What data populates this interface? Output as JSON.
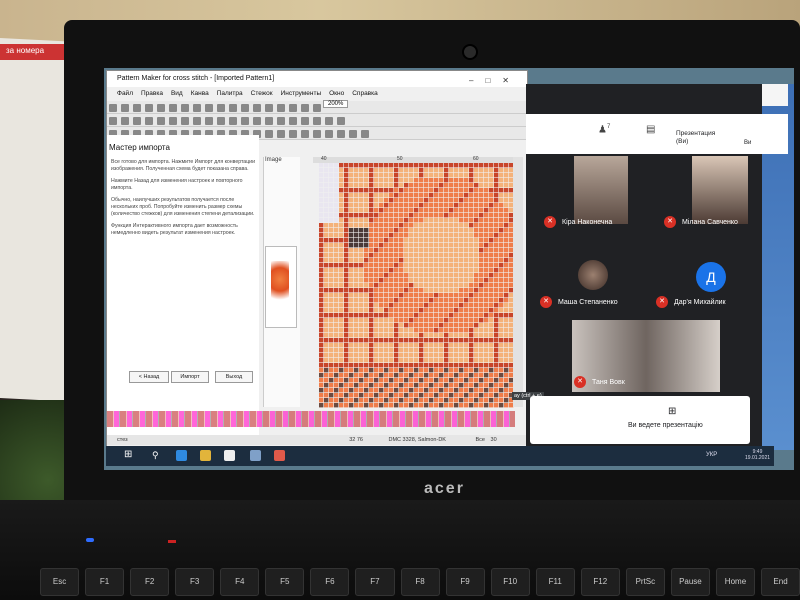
{
  "pattern_maker": {
    "title": "Pattern Maker for cross stitch - [Imported Pattern1]",
    "menu": [
      "Файл",
      "Правка",
      "Вид",
      "Канва",
      "Палитра",
      "Стежок",
      "Инструменты",
      "Окно",
      "Справка"
    ],
    "zoom": "200%",
    "wizard_title": "Мастер импорта",
    "wizard_paragraphs": [
      "Все готово для импорта. Нажмите Импорт для конвертации изображения. Полученная схема будет показана справа.",
      "Нажмите Назад для изменения настроек и повторного импорта.",
      "Обычно, наилучших результатов получается после нескольких проб. Попробуйте изменить размер схемы (количество стежков) для изменения степени детализации.",
      "Функция Интерактивного импорта дает возможность немедленно видеть результат изменения настроек."
    ],
    "btn_back": "< Назад",
    "btn_import": "Импорт",
    "btn_exit": "Выход",
    "image_label": "Image",
    "ruler": [
      "40",
      "50",
      "60"
    ],
    "status_left": "стез",
    "status_coords": "32  76",
    "status_color": "DMC  3328, Salmon-DK",
    "status_all": "Все",
    "status_zoom": "30"
  },
  "meet": {
    "presentation_label": "Презентация (Ви)",
    "you_label": "Ви",
    "participants_count": "7",
    "participants": [
      {
        "name": "Кіра Наконечна"
      },
      {
        "name": "Мілана Савченко"
      },
      {
        "name": "Маша Степаненко"
      },
      {
        "name": "Дар'я Михайлик",
        "initial": "Д"
      },
      {
        "name": "Таня Вовк"
      }
    ],
    "present_text": "Ви ведете презентацію",
    "tooltip": "ay (ctrl + e)"
  },
  "taskbar": {
    "lang": "УКР",
    "time": "9:49",
    "date": "19.01.2021"
  },
  "laptop": {
    "brand": "acer",
    "keys": [
      "Esc",
      "F1",
      "F2",
      "F3",
      "F4",
      "F5",
      "F6",
      "F7",
      "F8",
      "F9",
      "F10",
      "F11",
      "F12",
      "PrtSc",
      "Pause",
      "Home",
      "End"
    ]
  },
  "poster": {
    "heading": "за номера"
  },
  "colors": {
    "pattern_light": "#f4b27a",
    "pattern_mid": "#ef7d4a",
    "pattern_dark": "#c8452a",
    "meet_bg": "#202124",
    "mic_off": "#d93025",
    "avatar_blue": "#1a73e8"
  },
  "icons": [
    "people-icon",
    "chat-icon",
    "mic-off-icon",
    "present-icon",
    "windows-start-icon",
    "search-icon"
  ]
}
